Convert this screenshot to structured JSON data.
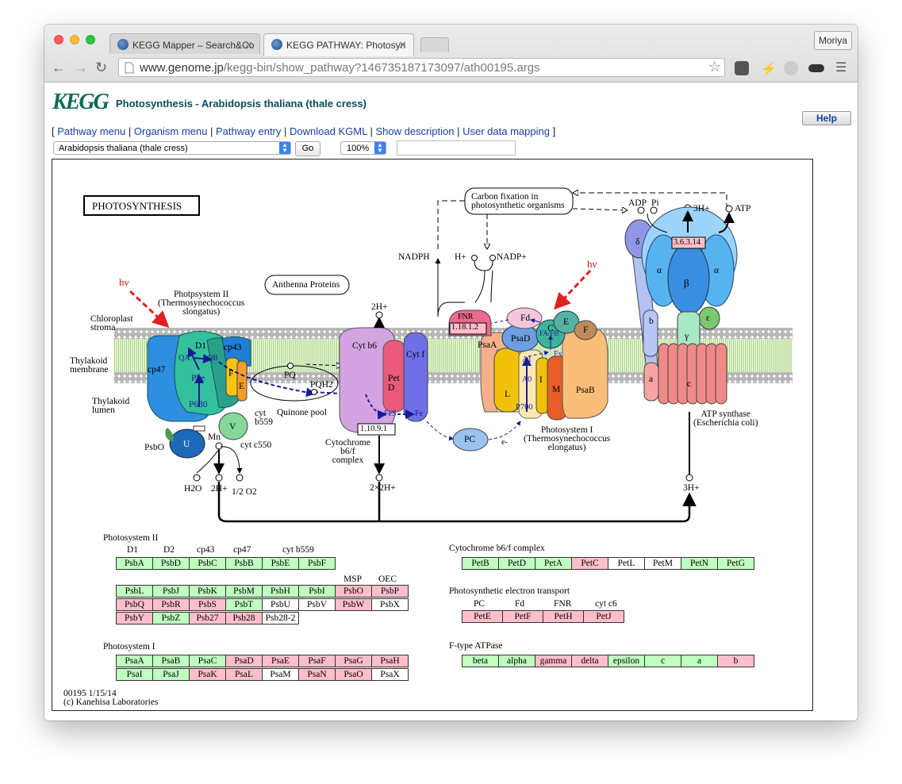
{
  "browser": {
    "tabs": [
      {
        "title": "KEGG Mapper – Search&Co",
        "active": false
      },
      {
        "title": "KEGG PATHWAY: Photosyn",
        "active": true
      }
    ],
    "user_button": "Moriya",
    "url_host": "www.genome.jp",
    "url_path": "/kegg-bin/show_pathway?146735187173097/ath00195.args"
  },
  "header": {
    "logo": "KEGG",
    "title": "Photosynthesis - Arabidopsis thaliana (thale cress)",
    "help_label": "Help"
  },
  "menu": {
    "open_bracket": "[",
    "close_bracket": "]",
    "separator": "|",
    "links": [
      "Pathway menu",
      "Organism menu",
      "Pathway entry",
      "Download KGML",
      "Show description",
      "User data mapping"
    ]
  },
  "controls": {
    "organism_select": "Arabidopsis thaliana (thale cress)",
    "go_label": "Go",
    "zoom_select": "100%",
    "search_value": ""
  },
  "diagram": {
    "title": "PHOTOSYNTHESIS",
    "labels": {
      "hv": "hν",
      "chloroplast_stroma": "Chloroplast\nstroma",
      "thylakoid_membrane": "Thylakoid\nmembrane",
      "thylakoid_lumen": "Thylakoid\nlumen",
      "psii_title": "Photpsystem II\n(Thermosynechococcus\nslongatus)",
      "antenna": "Anthenna Proteins",
      "carbon_fixation": "Carbon fixation in\nphotosynthetic organisms",
      "nadph": "NADPH",
      "h_plus": "H+",
      "nadp_plus": "NADP+",
      "two_h_plus_top": "2H+",
      "adp": "ADP",
      "pi": "Pi",
      "three_h_plus_top": "3H+",
      "atp": "ATP",
      "ec_atp": "3.6.3.14",
      "ec_fnr": "1.18.1.2",
      "ec_cyt": "1.10.9.1",
      "fnr": "FNR",
      "fd": "Fd",
      "psad": "PsaD",
      "psaa": "PsaA",
      "psab": "PsaB",
      "pc": "PC",
      "e_minus": "e-",
      "cytb6": "Cyt b6",
      "cytf": "Cyt f",
      "petd": "Pet\nD",
      "fes": "FeS",
      "fe": "Fe",
      "pq": "PQ",
      "pqh2": "PQH2",
      "quinone_pool": "Quinone pool",
      "cyt_b6f_complex": "Cytochrome\nb6/f\ncomplex",
      "psi_title": "Photosystem I\n(Thermosynechococcus\nelongatus)",
      "atp_synthase": "ATP synthase\n(Escherichia coli)",
      "psbo": "PsbO",
      "mn": "Mn",
      "h2o": "H2O",
      "two_h_plus_bottom": "2H+",
      "half_o2": "1/2 O2",
      "two_x_two_h_plus": "2×2H+",
      "three_h_plus_bottom": "3H+",
      "cyt_c550": "cyt c550",
      "cyt_b559": "cyt\nb559",
      "d1": "D1",
      "cp43": "cp43",
      "cp47": "cp47",
      "phe": "Phe",
      "p680": "P680",
      "qa": "QA",
      "qb": "QB",
      "u": "U",
      "v": "V",
      "f": "F",
      "e": "E",
      "l": "L",
      "i": "I",
      "m": "M",
      "a0": "A0",
      "a1": "A1",
      "fx": "Fx",
      "fafb": "FA/FB",
      "p700": "P700",
      "psae_e": "E",
      "psaf_f": "F",
      "psac_c": "C",
      "alpha": "α",
      "beta": "β",
      "gamma": "γ",
      "delta": "δ",
      "epsilon": "ε",
      "atp_a": "a",
      "atp_b": "b",
      "atp_c": "c"
    },
    "gene_tables": {
      "psii": {
        "title": "Photosystem II",
        "header": [
          "D1",
          "D2",
          "cp43",
          "cp47",
          "cyt b559"
        ],
        "row1": [
          {
            "name": "PsbA",
            "color": "g"
          },
          {
            "name": "PsbD",
            "color": "g"
          },
          {
            "name": "PsbC",
            "color": "g"
          },
          {
            "name": "PsbB",
            "color": "g"
          },
          {
            "name": "PsbE",
            "color": "g"
          },
          {
            "name": "PsbF",
            "color": "g"
          }
        ],
        "header2": [
          "MSP",
          "OEC"
        ],
        "rows": [
          [
            {
              "name": "PsbL",
              "color": "g"
            },
            {
              "name": "PsbJ",
              "color": "g"
            },
            {
              "name": "PsbK",
              "color": "g"
            },
            {
              "name": "PsbM",
              "color": "g"
            },
            {
              "name": "PsbH",
              "color": "g"
            },
            {
              "name": "PsbI",
              "color": "g"
            },
            {
              "name": "PsbO",
              "color": "p"
            },
            {
              "name": "PsbP",
              "color": "p"
            }
          ],
          [
            {
              "name": "PsbQ",
              "color": "p"
            },
            {
              "name": "PsbR",
              "color": "p"
            },
            {
              "name": "PsbS",
              "color": "p"
            },
            {
              "name": "PsbT",
              "color": "g"
            },
            {
              "name": "PsbU",
              "color": "w"
            },
            {
              "name": "PsbV",
              "color": "w"
            },
            {
              "name": "PsbW",
              "color": "p"
            },
            {
              "name": "PsbX",
              "color": "w"
            }
          ],
          [
            {
              "name": "PsbY",
              "color": "p"
            },
            {
              "name": "PsbZ",
              "color": "g"
            },
            {
              "name": "Psb27",
              "color": "p"
            },
            {
              "name": "Psb28",
              "color": "p"
            },
            {
              "name": "Psb28-2",
              "color": "w"
            }
          ]
        ]
      },
      "psi": {
        "title": "Photosystem I",
        "rows": [
          [
            {
              "name": "PsaA",
              "color": "g"
            },
            {
              "name": "PsaB",
              "color": "g"
            },
            {
              "name": "PsaC",
              "color": "g"
            },
            {
              "name": "PsaD",
              "color": "p"
            },
            {
              "name": "PsaE",
              "color": "p"
            },
            {
              "name": "PsaF",
              "color": "p"
            },
            {
              "name": "PsaG",
              "color": "p"
            },
            {
              "name": "PsaH",
              "color": "p"
            }
          ],
          [
            {
              "name": "PsaI",
              "color": "g"
            },
            {
              "name": "PsaJ",
              "color": "g"
            },
            {
              "name": "PsaK",
              "color": "p"
            },
            {
              "name": "PsaL",
              "color": "p"
            },
            {
              "name": "PsaM",
              "color": "w"
            },
            {
              "name": "PsaN",
              "color": "p"
            },
            {
              "name": "PsaO",
              "color": "p"
            },
            {
              "name": "PsaX",
              "color": "w"
            }
          ]
        ]
      },
      "cytb6f": {
        "title": "Cytochrome b6/f complex",
        "row": [
          {
            "name": "PetB",
            "color": "g"
          },
          {
            "name": "PetD",
            "color": "g"
          },
          {
            "name": "PetA",
            "color": "g"
          },
          {
            "name": "PetC",
            "color": "p"
          },
          {
            "name": "PetL",
            "color": "w"
          },
          {
            "name": "PetM",
            "color": "w"
          },
          {
            "name": "PetN",
            "color": "g"
          },
          {
            "name": "PetG",
            "color": "g"
          }
        ]
      },
      "pet": {
        "title": "Photosynthetic electron transport",
        "header": [
          "PC",
          "Fd",
          "FNR",
          "cyt c6"
        ],
        "row": [
          {
            "name": "PetE",
            "color": "p"
          },
          {
            "name": "PetF",
            "color": "p"
          },
          {
            "name": "PetH",
            "color": "p"
          },
          {
            "name": "PetJ",
            "color": "p"
          }
        ]
      },
      "atpase": {
        "title": "F-type ATPase",
        "row": [
          {
            "name": "beta",
            "color": "g"
          },
          {
            "name": "alpha",
            "color": "g"
          },
          {
            "name": "gamma",
            "color": "p"
          },
          {
            "name": "delta",
            "color": "p"
          },
          {
            "name": "epsilon",
            "color": "g"
          },
          {
            "name": "c",
            "color": "g"
          },
          {
            "name": "a",
            "color": "g"
          },
          {
            "name": "b",
            "color": "p"
          }
        ]
      }
    },
    "footer": {
      "version": "00195 1/15/14",
      "copyright": "(c) Kanehisa Laboratories"
    }
  },
  "colors": {
    "green_box": "#bfffbf",
    "pink_box": "#ffbfca",
    "link": "#173ea3",
    "title": "#0b4a5e"
  }
}
